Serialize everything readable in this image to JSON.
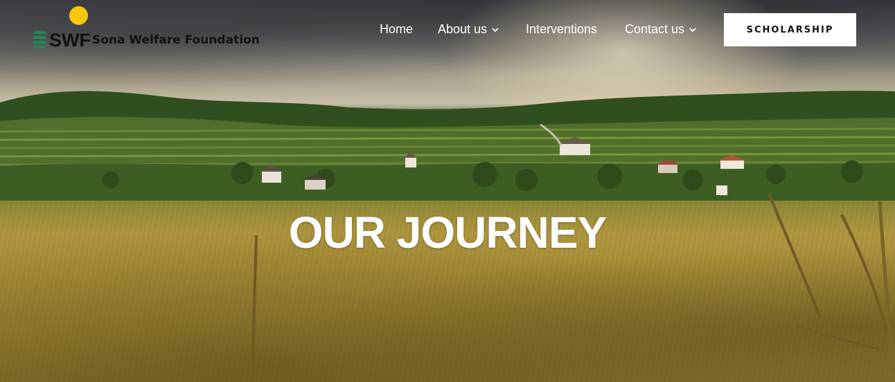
{
  "brand": {
    "abbr": "SWF",
    "name": "Sona Welfare Foundation",
    "colors": {
      "sun": "#f9c80e",
      "bars": "#1c8a5a",
      "text": "#111111"
    }
  },
  "nav": {
    "items": [
      {
        "label": "Home",
        "has_dropdown": false
      },
      {
        "label": "About us",
        "has_dropdown": true
      },
      {
        "label": "Interventions",
        "has_dropdown": false
      },
      {
        "label": "Contact us",
        "has_dropdown": true
      }
    ],
    "cta_label": "SCHOLARSHIP"
  },
  "hero": {
    "title": "OUR JOURNEY",
    "background": "countryside-wheat-field-image"
  },
  "icons": {
    "dropdown": "chevron-down-icon"
  }
}
